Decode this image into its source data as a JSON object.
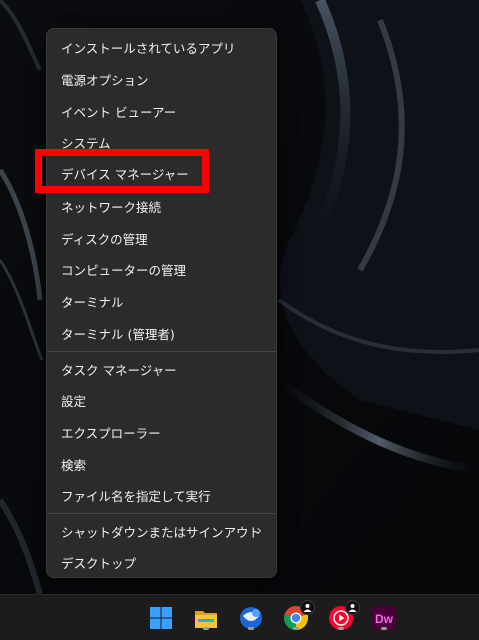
{
  "menu": {
    "items": [
      {
        "label": "インストールされているアプリ"
      },
      {
        "label": "電源オプション"
      },
      {
        "label": "イベント ビューアー"
      },
      {
        "label": "システム"
      },
      {
        "label": "デバイス マネージャー"
      },
      {
        "label": "ネットワーク接続"
      },
      {
        "label": "ディスクの管理"
      },
      {
        "label": "コンピューターの管理"
      },
      {
        "label": "ターミナル"
      },
      {
        "label": "ターミナル (管理者)"
      },
      {
        "label": "タスク マネージャー"
      },
      {
        "label": "設定"
      },
      {
        "label": "エクスプローラー"
      },
      {
        "label": "検索"
      },
      {
        "label": "ファイル名を指定して実行"
      },
      {
        "label": "シャットダウンまたはサインアウト",
        "has_submenu": true
      },
      {
        "label": "デスクトップ"
      }
    ],
    "highlighted_item": "デバイス マネージャー",
    "highlight_color": "#ff0000"
  },
  "taskbar": {
    "icons": [
      {
        "name": "windows-start-icon"
      },
      {
        "name": "file-explorer-icon"
      },
      {
        "name": "thunderbird-icon"
      },
      {
        "name": "chrome-icon"
      },
      {
        "name": "youtube-music-icon"
      },
      {
        "name": "dreamweaver-icon",
        "text": "Dw"
      }
    ]
  }
}
